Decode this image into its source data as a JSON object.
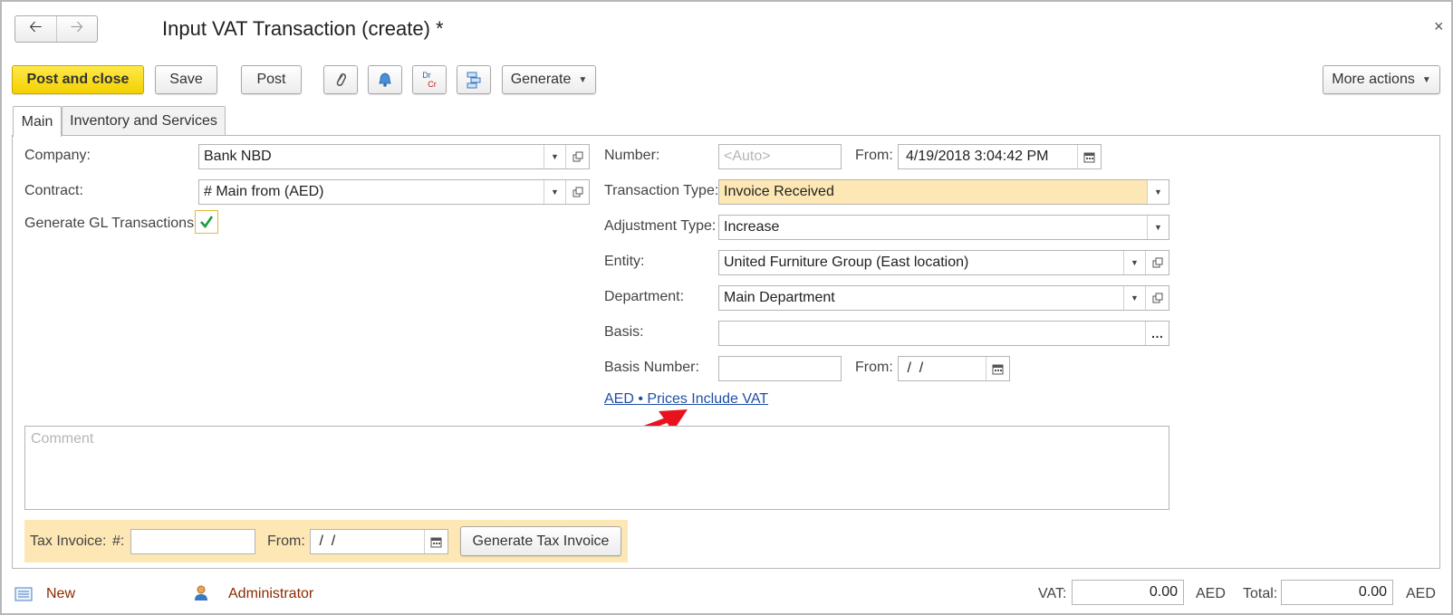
{
  "window": {
    "title": "Input VAT Transaction (create) *"
  },
  "toolbar": {
    "post_and_close": "Post and close",
    "save": "Save",
    "post": "Post",
    "generate": "Generate",
    "more_actions": "More actions",
    "drcr_dr": "Dr",
    "drcr_cr": "Cr"
  },
  "tabs": [
    {
      "label": "Main",
      "active": true
    },
    {
      "label": "Inventory and Services",
      "active": false
    }
  ],
  "form": {
    "company": {
      "label": "Company:",
      "value": "Bank NBD"
    },
    "contract": {
      "label": "Contract:",
      "value": "# Main from  (AED)"
    },
    "generate_gl": {
      "label": "Generate GL Transactions:",
      "checked": true
    },
    "number": {
      "label": "Number:",
      "placeholder": "<Auto>"
    },
    "from": {
      "label": "From:",
      "value": "4/19/2018  3:04:42 PM"
    },
    "transaction_type": {
      "label": "Transaction Type:",
      "value": "Invoice Received"
    },
    "adjustment_type": {
      "label": "Adjustment Type:",
      "value": "Increase"
    },
    "entity": {
      "label": "Entity:",
      "value": "United Furniture Group (East location)"
    },
    "department": {
      "label": "Department:",
      "value": "Main Department"
    },
    "basis": {
      "label": "Basis:",
      "value": ""
    },
    "basis_number": {
      "label": "Basis Number:",
      "value": ""
    },
    "basis_from": {
      "label": "From:",
      "value": " /  /"
    },
    "prices_link": "AED • Prices Include VAT",
    "comment_placeholder": "Comment"
  },
  "tax_invoice": {
    "label": "Tax Invoice:",
    "number_label": "#:",
    "number_value": "",
    "from_label": "From:",
    "from_value": " /  /",
    "generate_button": "Generate Tax Invoice"
  },
  "footer": {
    "new": "New",
    "user": "Administrator",
    "vat_label": "VAT:",
    "vat_value": "0.00",
    "vat_currency": "AED",
    "total_label": "Total:",
    "total_value": "0.00",
    "total_currency": "AED"
  },
  "colors": {
    "primary_button": "#f3d100",
    "highlight_field": "#fde7b4",
    "link": "#1f4fa8",
    "footer_link": "#8b2a00",
    "arrow": "#e8121e"
  }
}
